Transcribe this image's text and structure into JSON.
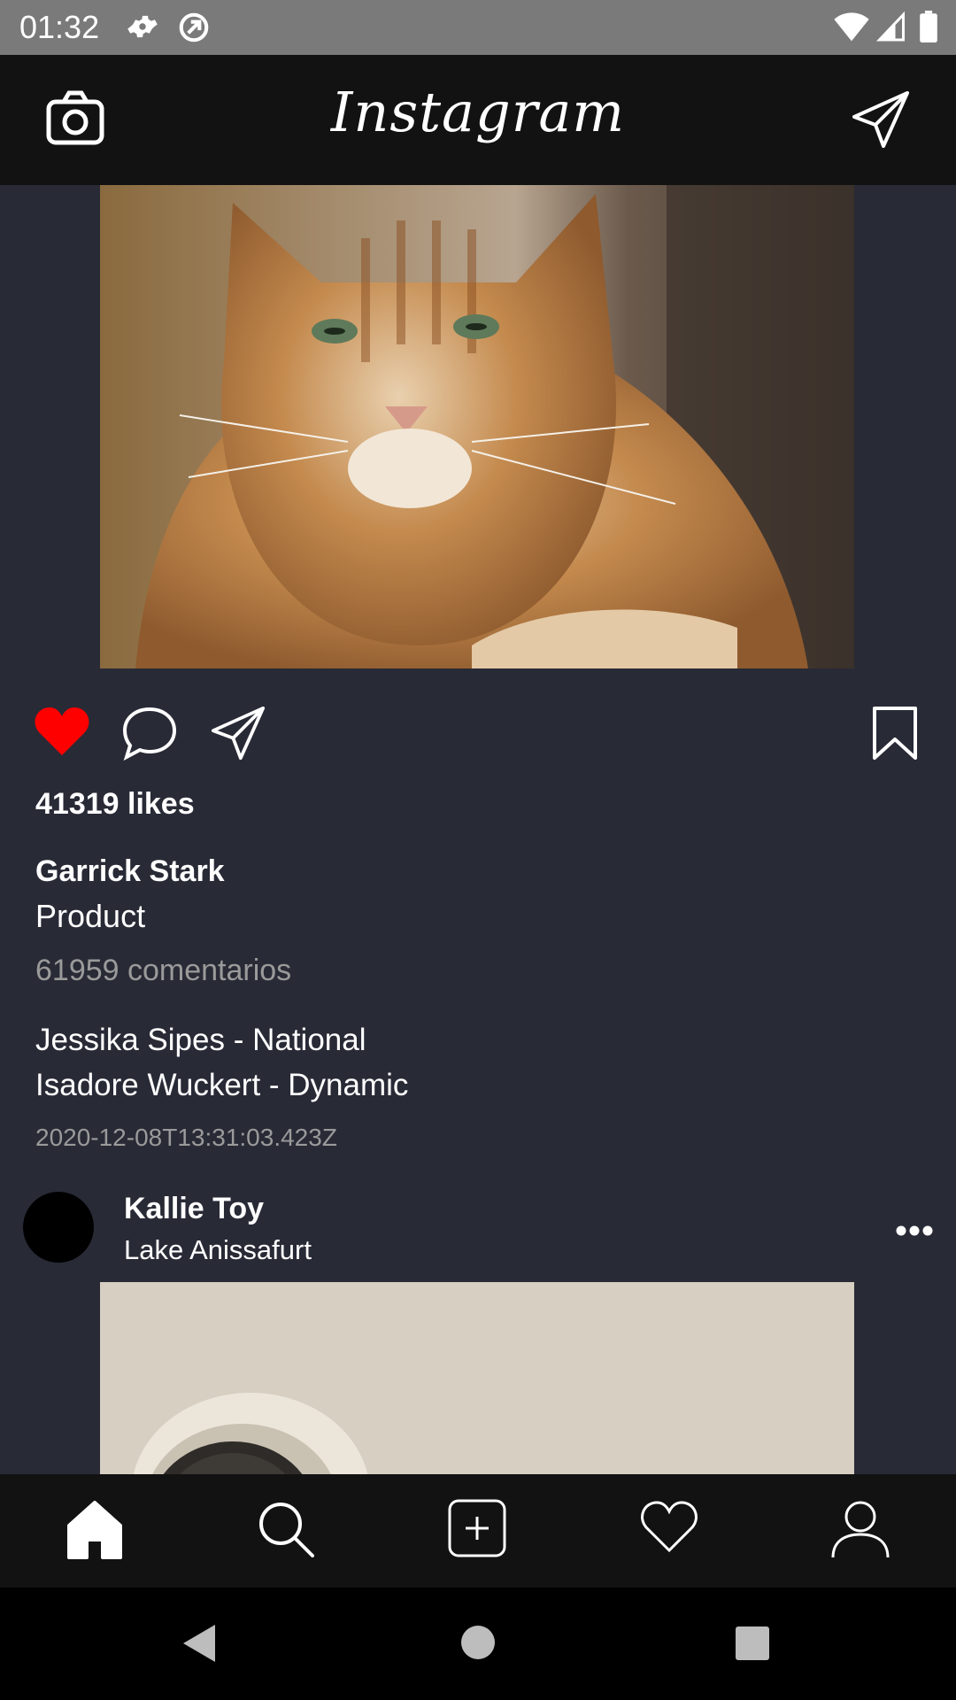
{
  "status_bar": {
    "time": "01:32",
    "icons": [
      "settings-icon",
      "sync-icon",
      "wifi-icon",
      "signal-icon",
      "battery-icon"
    ],
    "background": "#7a7a7a"
  },
  "header": {
    "title": "Instagram",
    "left_icon": "camera-icon",
    "right_icon": "direct-message-icon",
    "background": "#121212"
  },
  "post": {
    "image": "orange-tabby-cat-photo",
    "liked": true,
    "like_color": "#ff0000",
    "likes": "41319 likes",
    "author": "Garrick Stark",
    "caption": "Product",
    "comments_link": "61959 comentarios",
    "comments": [
      "Jessika Sipes - National",
      "Isadore Wuckert - Dynamic"
    ],
    "timestamp": "2020-12-08T13:31:03.423Z"
  },
  "next_post": {
    "user": "Kallie Toy",
    "location": "Lake Anissafurt",
    "image": "speaker-photo"
  },
  "bottom_nav": {
    "items": [
      "home-icon",
      "search-icon",
      "add-post-icon",
      "activity-heart-icon",
      "profile-icon"
    ],
    "active": "home-icon"
  },
  "system_nav": {
    "items": [
      "back-button",
      "home-button",
      "recents-button"
    ]
  },
  "colors": {
    "feed_background": "#282a36",
    "text_primary": "#ffffff",
    "text_secondary": "#9a9a9a"
  }
}
